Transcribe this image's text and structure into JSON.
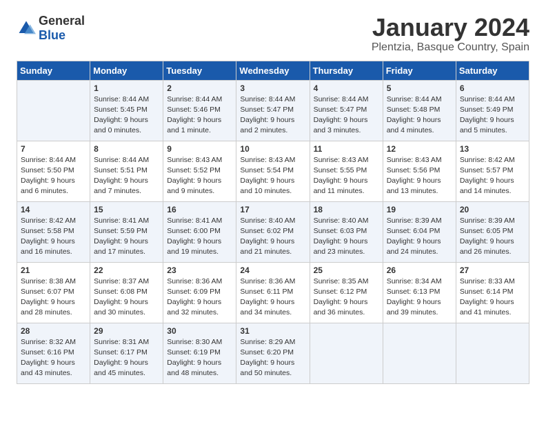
{
  "header": {
    "logo": {
      "general": "General",
      "blue": "Blue"
    },
    "title": "January 2024",
    "location": "Plentzia, Basque Country, Spain"
  },
  "days_of_week": [
    "Sunday",
    "Monday",
    "Tuesday",
    "Wednesday",
    "Thursday",
    "Friday",
    "Saturday"
  ],
  "weeks": [
    [
      {
        "day": "",
        "sunrise": "",
        "sunset": "",
        "daylight": ""
      },
      {
        "day": "1",
        "sunrise": "Sunrise: 8:44 AM",
        "sunset": "Sunset: 5:45 PM",
        "daylight": "Daylight: 9 hours and 0 minutes."
      },
      {
        "day": "2",
        "sunrise": "Sunrise: 8:44 AM",
        "sunset": "Sunset: 5:46 PM",
        "daylight": "Daylight: 9 hours and 1 minute."
      },
      {
        "day": "3",
        "sunrise": "Sunrise: 8:44 AM",
        "sunset": "Sunset: 5:47 PM",
        "daylight": "Daylight: 9 hours and 2 minutes."
      },
      {
        "day": "4",
        "sunrise": "Sunrise: 8:44 AM",
        "sunset": "Sunset: 5:47 PM",
        "daylight": "Daylight: 9 hours and 3 minutes."
      },
      {
        "day": "5",
        "sunrise": "Sunrise: 8:44 AM",
        "sunset": "Sunset: 5:48 PM",
        "daylight": "Daylight: 9 hours and 4 minutes."
      },
      {
        "day": "6",
        "sunrise": "Sunrise: 8:44 AM",
        "sunset": "Sunset: 5:49 PM",
        "daylight": "Daylight: 9 hours and 5 minutes."
      }
    ],
    [
      {
        "day": "7",
        "sunrise": "Sunrise: 8:44 AM",
        "sunset": "Sunset: 5:50 PM",
        "daylight": "Daylight: 9 hours and 6 minutes."
      },
      {
        "day": "8",
        "sunrise": "Sunrise: 8:44 AM",
        "sunset": "Sunset: 5:51 PM",
        "daylight": "Daylight: 9 hours and 7 minutes."
      },
      {
        "day": "9",
        "sunrise": "Sunrise: 8:43 AM",
        "sunset": "Sunset: 5:52 PM",
        "daylight": "Daylight: 9 hours and 9 minutes."
      },
      {
        "day": "10",
        "sunrise": "Sunrise: 8:43 AM",
        "sunset": "Sunset: 5:54 PM",
        "daylight": "Daylight: 9 hours and 10 minutes."
      },
      {
        "day": "11",
        "sunrise": "Sunrise: 8:43 AM",
        "sunset": "Sunset: 5:55 PM",
        "daylight": "Daylight: 9 hours and 11 minutes."
      },
      {
        "day": "12",
        "sunrise": "Sunrise: 8:43 AM",
        "sunset": "Sunset: 5:56 PM",
        "daylight": "Daylight: 9 hours and 13 minutes."
      },
      {
        "day": "13",
        "sunrise": "Sunrise: 8:42 AM",
        "sunset": "Sunset: 5:57 PM",
        "daylight": "Daylight: 9 hours and 14 minutes."
      }
    ],
    [
      {
        "day": "14",
        "sunrise": "Sunrise: 8:42 AM",
        "sunset": "Sunset: 5:58 PM",
        "daylight": "Daylight: 9 hours and 16 minutes."
      },
      {
        "day": "15",
        "sunrise": "Sunrise: 8:41 AM",
        "sunset": "Sunset: 5:59 PM",
        "daylight": "Daylight: 9 hours and 17 minutes."
      },
      {
        "day": "16",
        "sunrise": "Sunrise: 8:41 AM",
        "sunset": "Sunset: 6:00 PM",
        "daylight": "Daylight: 9 hours and 19 minutes."
      },
      {
        "day": "17",
        "sunrise": "Sunrise: 8:40 AM",
        "sunset": "Sunset: 6:02 PM",
        "daylight": "Daylight: 9 hours and 21 minutes."
      },
      {
        "day": "18",
        "sunrise": "Sunrise: 8:40 AM",
        "sunset": "Sunset: 6:03 PM",
        "daylight": "Daylight: 9 hours and 23 minutes."
      },
      {
        "day": "19",
        "sunrise": "Sunrise: 8:39 AM",
        "sunset": "Sunset: 6:04 PM",
        "daylight": "Daylight: 9 hours and 24 minutes."
      },
      {
        "day": "20",
        "sunrise": "Sunrise: 8:39 AM",
        "sunset": "Sunset: 6:05 PM",
        "daylight": "Daylight: 9 hours and 26 minutes."
      }
    ],
    [
      {
        "day": "21",
        "sunrise": "Sunrise: 8:38 AM",
        "sunset": "Sunset: 6:07 PM",
        "daylight": "Daylight: 9 hours and 28 minutes."
      },
      {
        "day": "22",
        "sunrise": "Sunrise: 8:37 AM",
        "sunset": "Sunset: 6:08 PM",
        "daylight": "Daylight: 9 hours and 30 minutes."
      },
      {
        "day": "23",
        "sunrise": "Sunrise: 8:36 AM",
        "sunset": "Sunset: 6:09 PM",
        "daylight": "Daylight: 9 hours and 32 minutes."
      },
      {
        "day": "24",
        "sunrise": "Sunrise: 8:36 AM",
        "sunset": "Sunset: 6:11 PM",
        "daylight": "Daylight: 9 hours and 34 minutes."
      },
      {
        "day": "25",
        "sunrise": "Sunrise: 8:35 AM",
        "sunset": "Sunset: 6:12 PM",
        "daylight": "Daylight: 9 hours and 36 minutes."
      },
      {
        "day": "26",
        "sunrise": "Sunrise: 8:34 AM",
        "sunset": "Sunset: 6:13 PM",
        "daylight": "Daylight: 9 hours and 39 minutes."
      },
      {
        "day": "27",
        "sunrise": "Sunrise: 8:33 AM",
        "sunset": "Sunset: 6:14 PM",
        "daylight": "Daylight: 9 hours and 41 minutes."
      }
    ],
    [
      {
        "day": "28",
        "sunrise": "Sunrise: 8:32 AM",
        "sunset": "Sunset: 6:16 PM",
        "daylight": "Daylight: 9 hours and 43 minutes."
      },
      {
        "day": "29",
        "sunrise": "Sunrise: 8:31 AM",
        "sunset": "Sunset: 6:17 PM",
        "daylight": "Daylight: 9 hours and 45 minutes."
      },
      {
        "day": "30",
        "sunrise": "Sunrise: 8:30 AM",
        "sunset": "Sunset: 6:19 PM",
        "daylight": "Daylight: 9 hours and 48 minutes."
      },
      {
        "day": "31",
        "sunrise": "Sunrise: 8:29 AM",
        "sunset": "Sunset: 6:20 PM",
        "daylight": "Daylight: 9 hours and 50 minutes."
      },
      {
        "day": "",
        "sunrise": "",
        "sunset": "",
        "daylight": ""
      },
      {
        "day": "",
        "sunrise": "",
        "sunset": "",
        "daylight": ""
      },
      {
        "day": "",
        "sunrise": "",
        "sunset": "",
        "daylight": ""
      }
    ]
  ]
}
